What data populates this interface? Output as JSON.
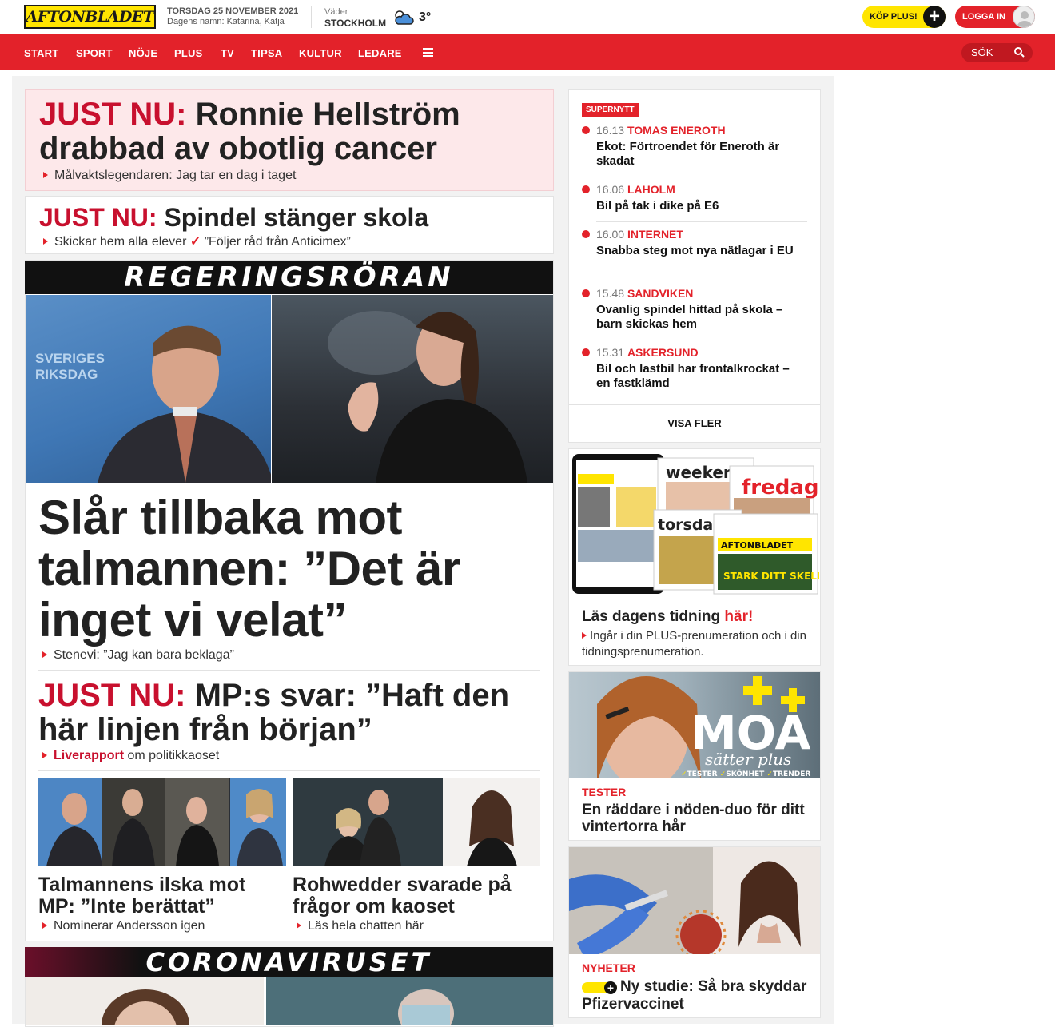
{
  "header": {
    "logo_text": "AFTONBLADET",
    "date": "TORSDAG 25 NOVEMBER 2021",
    "namedays": "Dagens namn: Katarina, Katja",
    "weather_label": "Väder",
    "weather_city": "STOCKHOLM",
    "weather_temp": "3°",
    "weather_icon": "partly-cloudy-icon",
    "buy_plus": "KÖP PLUS!",
    "login": "LOGGA IN"
  },
  "nav": {
    "items": [
      "START",
      "SPORT",
      "NÖJE",
      "PLUS",
      "TV",
      "TIPSA",
      "KULTUR",
      "LEDARE"
    ],
    "search_placeholder": "SÖK"
  },
  "colors": {
    "brand_red": "#e3222a",
    "brand_yellow": "#ffe500"
  },
  "main": {
    "breaking1": {
      "label": "JUST NU:",
      "title": "Ronnie Hellström drabbad av obotlig cancer",
      "sub": "Målvaktslegendaren: Jag tar en dag i taget"
    },
    "breaking2": {
      "label": "JUST NU:",
      "title": "Spindel stänger skola",
      "sub1": "Skickar hem alla elever",
      "sub2": "”Följer råd från Anticimex”"
    },
    "banner1": "REGERINGSRÖRAN",
    "photo_text": "SVERIGES RIKSDAG",
    "lead": {
      "title": "Slår tillbaka mot talmannen: ”Det är inget vi velat”",
      "sub": "Stenevi: ”Jag kan bara beklaga”"
    },
    "mp": {
      "label": "JUST NU:",
      "title": "MP:s svar: ”Haft den här linjen från början”",
      "sub_link": "Liverapport",
      "sub_rest": "om politikkaoset"
    },
    "small1": {
      "title": "Talmannens ilska mot MP: ”Inte berättat”",
      "sub": "Nominerar Andersson igen"
    },
    "small2": {
      "title": "Rohwedder svarade på frågor om kaoset",
      "sub": "Läs hela chatten här"
    },
    "banner2": "CORONAVIRUSET"
  },
  "supernytt": {
    "tag": "SUPERNYTT",
    "items": [
      {
        "time": "16.13",
        "topic": "TOMAS ENEROTH",
        "title": "Ekot: Förtroendet för Eneroth är skadat"
      },
      {
        "time": "16.06",
        "topic": "LAHOLM",
        "title": "Bil på tak i dike på E6"
      },
      {
        "time": "16.00",
        "topic": "INTERNET",
        "title": "Snabba steg mot nya nätlagar i EU"
      },
      {
        "time": "15.48",
        "topic": "SANDVIKEN",
        "title": "Ovanlig spindel hittad på skola – barn skickas hem"
      },
      {
        "time": "15.31",
        "topic": "ASKERSUND",
        "title": "Bil och lastbil har frontalkrockat – en fastklämd"
      }
    ],
    "more": "VISA FLER"
  },
  "etidning": {
    "title_a": "Läs dagens tidning",
    "title_b": "här!",
    "sub": "Ingår i din PLUS-prenumeration och i din tidningsprenumeration.",
    "mag_weekend": "weekend",
    "mag_fredag": "fredag",
    "mag_torsdag": "torsdag",
    "mag_logo": "AFTONBLADET",
    "mag_headline": "STARK DITT SKELETT"
  },
  "moa": {
    "brand": "MOA",
    "script": "sätter plus",
    "ticks": [
      "TESTER",
      "SKÖNHET",
      "TRENDER"
    ],
    "kicker": "TESTER",
    "title": "En räddare i nöden-duo för ditt vintertorra hår"
  },
  "vaccine": {
    "kicker": "NYHETER",
    "title": "Ny studie: Så bra skyddar Pfizervaccinet"
  }
}
